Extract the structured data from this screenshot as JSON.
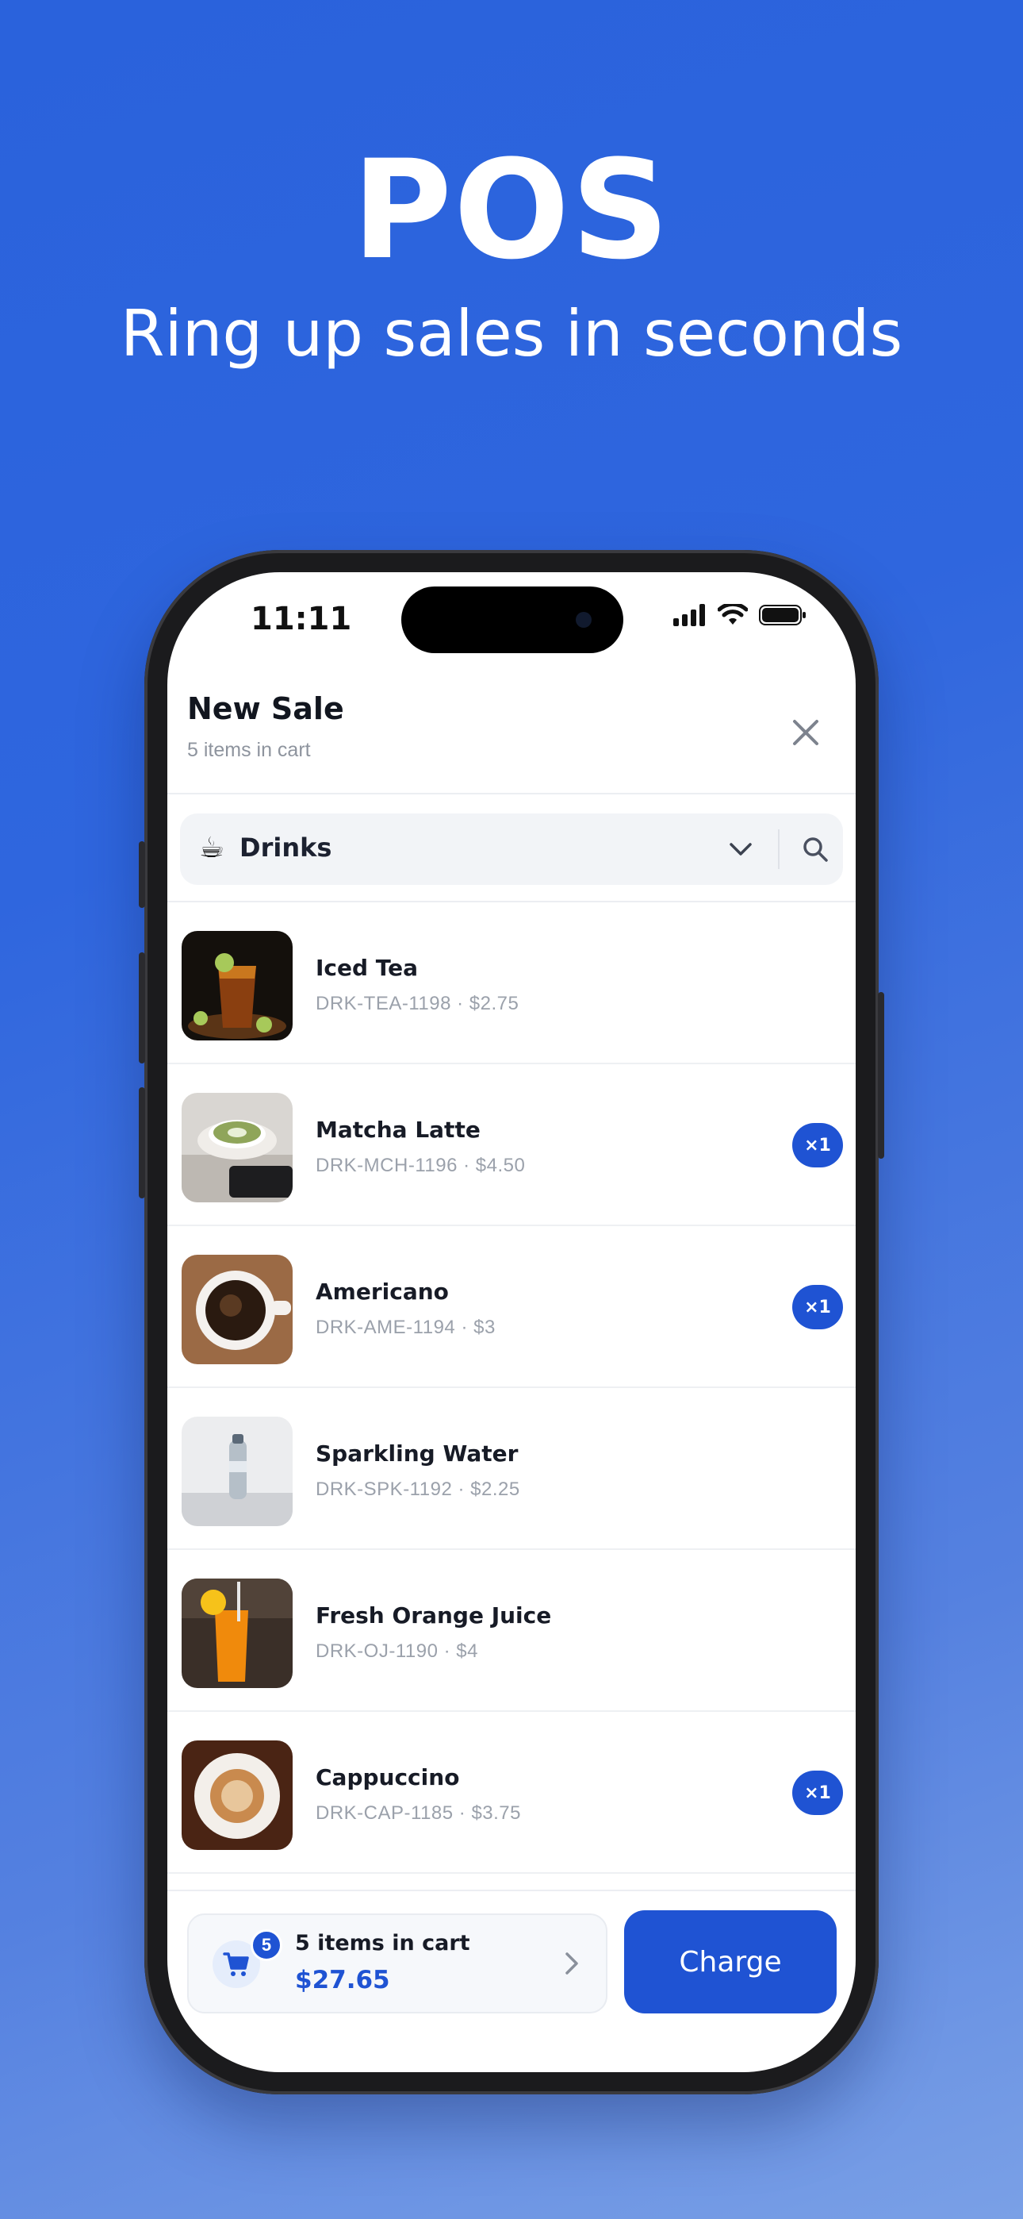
{
  "hero": {
    "title": "POS",
    "subtitle": "Ring up sales in seconds"
  },
  "status_bar": {
    "time": "11:11"
  },
  "header": {
    "title": "New Sale",
    "subtitle": "5 items in cart"
  },
  "category": {
    "emoji": "☕",
    "label": "Drinks"
  },
  "products": [
    {
      "name": "Iced Tea",
      "meta": "DRK-TEA-1198 · $2.75",
      "qty": "",
      "image": "iced-tea-photo"
    },
    {
      "name": "Matcha Latte",
      "meta": "DRK-MCH-1196 · $4.50",
      "qty": "×1",
      "image": "matcha-latte-photo"
    },
    {
      "name": "Americano",
      "meta": "DRK-AME-1194 · $3",
      "qty": "×1",
      "image": "americano-photo"
    },
    {
      "name": "Sparkling Water",
      "meta": "DRK-SPK-1192 · $2.25",
      "qty": "",
      "image": "sparkling-water-photo"
    },
    {
      "name": "Fresh Orange Juice",
      "meta": "DRK-OJ-1190 · $4",
      "qty": "",
      "image": "orange-juice-photo"
    },
    {
      "name": "Cappuccino",
      "meta": "DRK-CAP-1185 · $3.75",
      "qty": "×1",
      "image": "cappuccino-photo"
    }
  ],
  "footer": {
    "badge": "5",
    "cart_label": "5 items in cart",
    "cart_total": "$27.65",
    "charge_label": "Charge"
  },
  "colors": {
    "accent": "#1f53d3",
    "background": "#2f66de"
  }
}
